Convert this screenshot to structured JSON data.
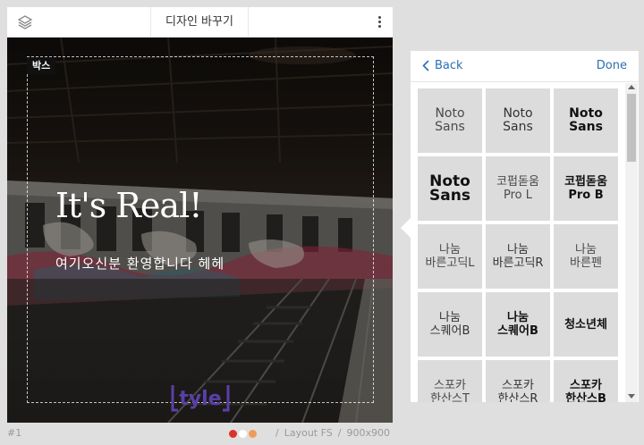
{
  "editor": {
    "title": "디자인 바꾸기",
    "box_label": "박스",
    "headline": "It's Real!",
    "subline": "여기오신분 환영합니다 헤헤",
    "logo_text": "tyle"
  },
  "footer": {
    "slide_number": "#1",
    "layout_label": "Layout FS",
    "size_label": "900x900",
    "separator": "/",
    "colors": [
      "#d9342b",
      "#ffffff",
      "#f19a5b"
    ]
  },
  "panel": {
    "back_label": "Back",
    "done_label": "Done",
    "fonts": [
      {
        "label": "Noto\nSans",
        "weight": "light"
      },
      {
        "label": "Noto\nSans",
        "weight": "regular"
      },
      {
        "label": "Noto\nSans",
        "weight": "medium"
      },
      {
        "label": "Noto\nSans",
        "weight": "bold"
      },
      {
        "label": "코펍돋움\nPro L",
        "weight": "light"
      },
      {
        "label": "코펍돋움\nPro B",
        "weight": "bold"
      },
      {
        "label": "나눔\n바른고딕L",
        "weight": "light"
      },
      {
        "label": "나눔\n바른고딕R",
        "weight": "regular"
      },
      {
        "label": "나눔\n바른펜",
        "weight": "light"
      },
      {
        "label": "나눔\n스퀘어B",
        "weight": "regular"
      },
      {
        "label": "나눔\n스퀘어B",
        "weight": "bold"
      },
      {
        "label": "청소년체",
        "weight": "bold"
      },
      {
        "label": "스포카\n한산스T",
        "weight": "light"
      },
      {
        "label": "스포카\n한산스R",
        "weight": "regular"
      },
      {
        "label": "스포카\n한산스B",
        "weight": "bold"
      }
    ]
  },
  "icons": {
    "layers": "layers-icon",
    "more": "more-vertical-icon",
    "back": "chevron-left-icon"
  },
  "colors": {
    "accent": "#2d6fb1",
    "tile": "#dcdcdc",
    "page_bg": "#dfdfdf",
    "logo": "#5b3fa8"
  }
}
